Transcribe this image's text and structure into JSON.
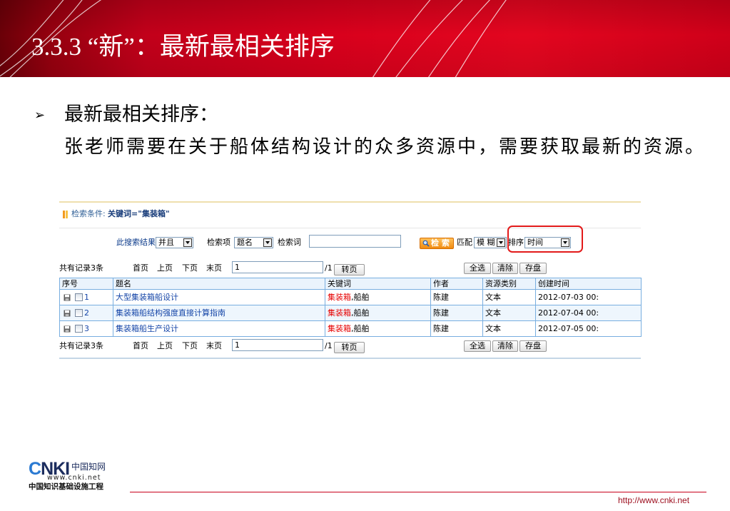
{
  "slide": {
    "title": "3.3.3 “新”：最新最相关排序",
    "bullet_marker": "➢",
    "bullet_heading": "最新最相关排序：",
    "bullet_text": "张老师需要在关于船体结构设计的众多资源中，需要获取最新的资源。"
  },
  "search": {
    "condition_label": "检索条件:",
    "condition_value": "关键词=\"集装箱\"",
    "scope_label": "此搜索结果",
    "scope_select": "并且",
    "field_label": "检索项",
    "field_select": "题名",
    "term_label": "检索词",
    "term_value": "",
    "search_button": "检 索",
    "match_label": "匹配",
    "match_select": "模 糊",
    "sort_label": "排序",
    "sort_select": "时间"
  },
  "pager": {
    "total": "共有记录3条",
    "first": "首页",
    "prev": "上页",
    "next": "下页",
    "last": "末页",
    "page_value": "1",
    "page_total": "/1",
    "goto": "转页",
    "select_all": "全选",
    "clear": "清除",
    "save": "存盘"
  },
  "table": {
    "columns": [
      "序号",
      "题名",
      "关键词",
      "作者",
      "资源类别",
      "创建时间"
    ],
    "rows": [
      {
        "no": "1",
        "title": "大型集装箱船设计",
        "keyword_match": "集装箱",
        "keyword_rest": ",船舶",
        "author": "陈建",
        "type": "文本",
        "created": "2012-07-03 00:"
      },
      {
        "no": "2",
        "title": "集装箱船结构强度直接计算指南",
        "keyword_match": "集装箱",
        "keyword_rest": ",船舶",
        "author": "陈建",
        "type": "文本",
        "created": "2012-07-04 00:"
      },
      {
        "no": "3",
        "title": "集装箱船生产设计",
        "keyword_match": "集装箱",
        "keyword_rest": ",船舶",
        "author": "陈建",
        "type": "文本",
        "created": "2012-07-05 00:"
      }
    ]
  },
  "footer": {
    "logo_brand": "CNKI",
    "logo_cn_name": "中国知网",
    "logo_url": "www.cnki.net",
    "logo_tagline": "中国知识基础设施工程",
    "url": "http://www.cnki.net"
  },
  "icons": {
    "condition": "bars-icon",
    "search_button": "magnifier-icon",
    "row_action": "disk-icon",
    "select_arrow": "chevron-down-icon"
  },
  "colors": {
    "banner_red": "#d8001c",
    "banner_dark": "#6a0008",
    "highlight_box": "#e21a1a",
    "link_blue": "#1646a8",
    "keyword_red": "#e60000",
    "search_button_orange": "#f08a10",
    "table_border": "#78aee0",
    "footer_red": "#c8001a"
  }
}
